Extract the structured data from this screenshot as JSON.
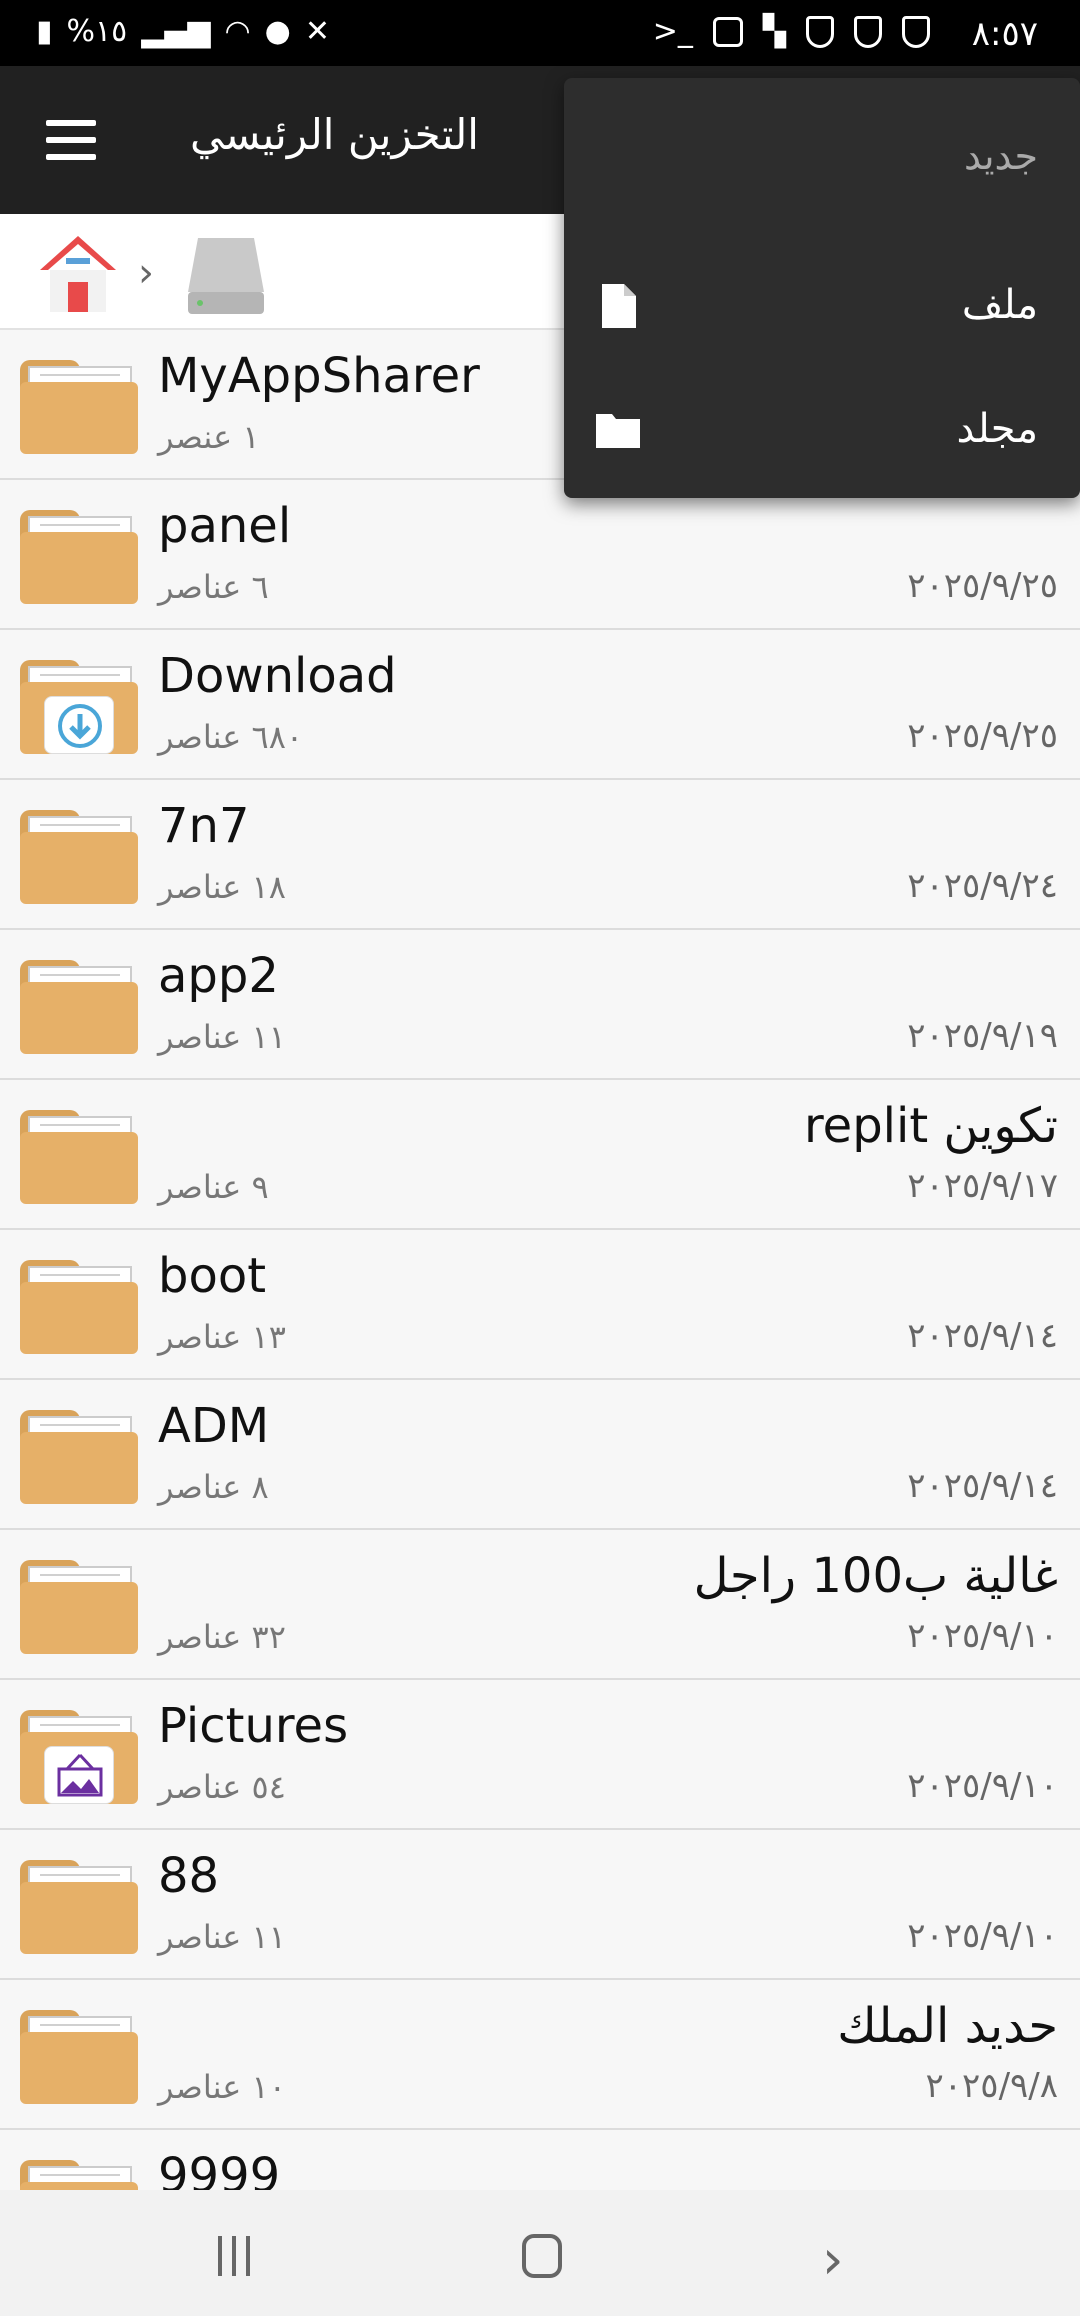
{
  "status_bar": {
    "time": "٨:٥٧",
    "battery": "%١٥"
  },
  "app_bar": {
    "title": "التخزين الرئيسي"
  },
  "popup_menu": {
    "header": "جديد",
    "items": [
      {
        "label": "ملف",
        "icon": "file-icon"
      },
      {
        "label": "مجلد",
        "icon": "folder-icon"
      }
    ]
  },
  "files": [
    {
      "name": "MyAppSharer",
      "items": "١ عنصر",
      "date": "",
      "badge": "none",
      "rtl": false
    },
    {
      "name": "panel",
      "items": "٦ عناصر",
      "date": "٢٠٢٥/٩/٢٥",
      "badge": "none",
      "rtl": false
    },
    {
      "name": "Download",
      "items": "٦٨٠ عناصر",
      "date": "٢٠٢٥/٩/٢٥",
      "badge": "download",
      "rtl": false
    },
    {
      "name": "7n7",
      "items": "١٨ عناصر",
      "date": "٢٠٢٥/٩/٢٤",
      "badge": "none",
      "rtl": false
    },
    {
      "name": "app2",
      "items": "١١ عناصر",
      "date": "٢٠٢٥/٩/١٩",
      "badge": "none",
      "rtl": false
    },
    {
      "name": "تكوين replit",
      "items": "٩ عناصر",
      "date": "٢٠٢٥/٩/١٧",
      "badge": "none",
      "rtl": true
    },
    {
      "name": "boot",
      "items": "١٣ عناصر",
      "date": "٢٠٢٥/٩/١٤",
      "badge": "none",
      "rtl": false
    },
    {
      "name": "ADM",
      "items": "٨ عناصر",
      "date": "٢٠٢٥/٩/١٤",
      "badge": "none",
      "rtl": false
    },
    {
      "name": "غالية ب100 راجل",
      "items": "٣٢ عناصر",
      "date": "٢٠٢٥/٩/١٠",
      "badge": "none",
      "rtl": true
    },
    {
      "name": "Pictures",
      "items": "٥٤ عناصر",
      "date": "٢٠٢٥/٩/١٠",
      "badge": "pictures",
      "rtl": false
    },
    {
      "name": "88",
      "items": "١١ عناصر",
      "date": "٢٠٢٥/٩/١٠",
      "badge": "none",
      "rtl": false
    },
    {
      "name": "حديد الملك",
      "items": "١٠ عناصر",
      "date": "٢٠٢٥/٩/٨",
      "badge": "none",
      "rtl": true
    },
    {
      "name": "9999",
      "items": "",
      "date": "",
      "badge": "none",
      "rtl": false
    }
  ],
  "colors": {
    "app_bar": "#212121",
    "popup": "#2d2d2d",
    "folder": "#e6b068"
  }
}
